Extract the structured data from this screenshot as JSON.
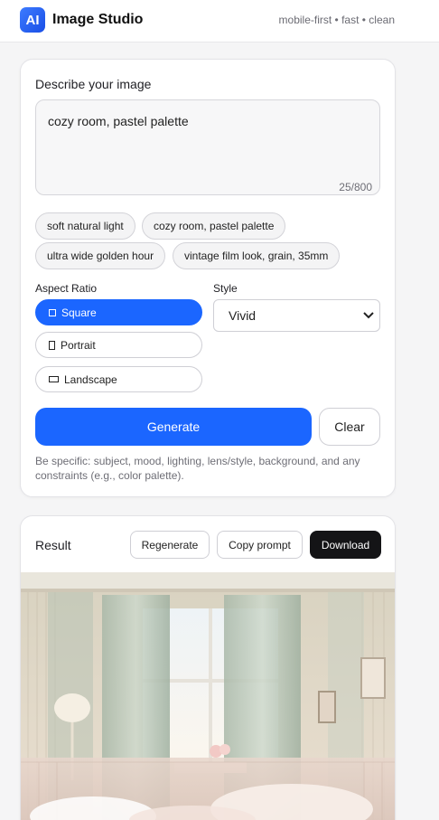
{
  "header": {
    "logo_text": "AI",
    "title": "Image Studio",
    "tagline": "mobile-first • fast • clean"
  },
  "prompt": {
    "label": "Describe your image",
    "value": "cozy room, pastel palette",
    "char_count": "25/800",
    "chips": [
      "soft natural light",
      "cozy room, pastel palette",
      "ultra wide golden hour",
      "vintage film look, grain, 35mm"
    ]
  },
  "aspect_ratio": {
    "label": "Aspect Ratio",
    "options": [
      {
        "label": "Square",
        "icon": "square-icon",
        "selected": true
      },
      {
        "label": "Portrait",
        "icon": "portrait-icon",
        "selected": false
      },
      {
        "label": "Landscape",
        "icon": "landscape-icon",
        "selected": false
      }
    ]
  },
  "style": {
    "label": "Style",
    "selected": "Vivid"
  },
  "actions": {
    "generate_label": "Generate",
    "clear_label": "Clear"
  },
  "hint": "Be specific: subject, mood, lighting, lens/style, background, and any constraints (e.g., color palette).",
  "result": {
    "title": "Result",
    "regenerate_label": "Regenerate",
    "copy_label": "Copy prompt",
    "download_label": "Download"
  },
  "colors": {
    "accent": "#1b66ff",
    "dark_button": "#141416",
    "muted_text": "#6e6e76"
  }
}
